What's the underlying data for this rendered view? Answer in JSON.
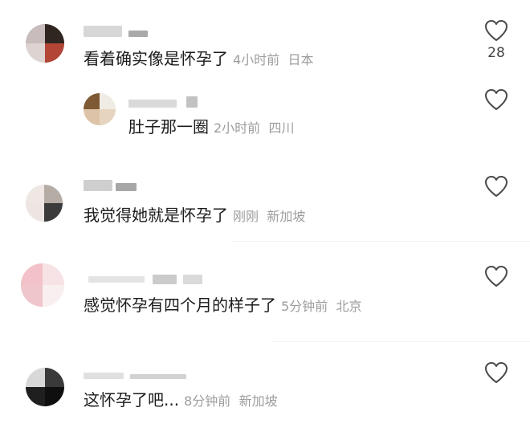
{
  "colors": {
    "comment_text": "#1b1b1b",
    "meta_text": "#9d9d9d",
    "like_outline": "#4a4a4a",
    "like_count": "#444444"
  },
  "comments": [
    {
      "text": "看着确实像是怀孕了",
      "time": "4小时前",
      "location": "日本",
      "likes": "28",
      "reply": false,
      "icon": "heart-outline-icon"
    },
    {
      "text": "肚子那一圈",
      "time": "2小时前",
      "location": "四川",
      "likes": "",
      "reply": true,
      "icon": "heart-outline-icon"
    },
    {
      "text": "我觉得她就是怀孕了",
      "time": "刚刚",
      "location": "新加坡",
      "likes": "",
      "reply": false,
      "icon": "heart-outline-icon"
    },
    {
      "text": "感觉怀孕有四个月的样子了",
      "time": "5分钟前",
      "location": "北京",
      "likes": "",
      "reply": false,
      "icon": "heart-outline-icon"
    },
    {
      "text": "这怀孕了吧...",
      "time": "8分钟前",
      "location": "新加坡",
      "likes": "",
      "reply": false,
      "icon": "heart-outline-icon"
    }
  ]
}
